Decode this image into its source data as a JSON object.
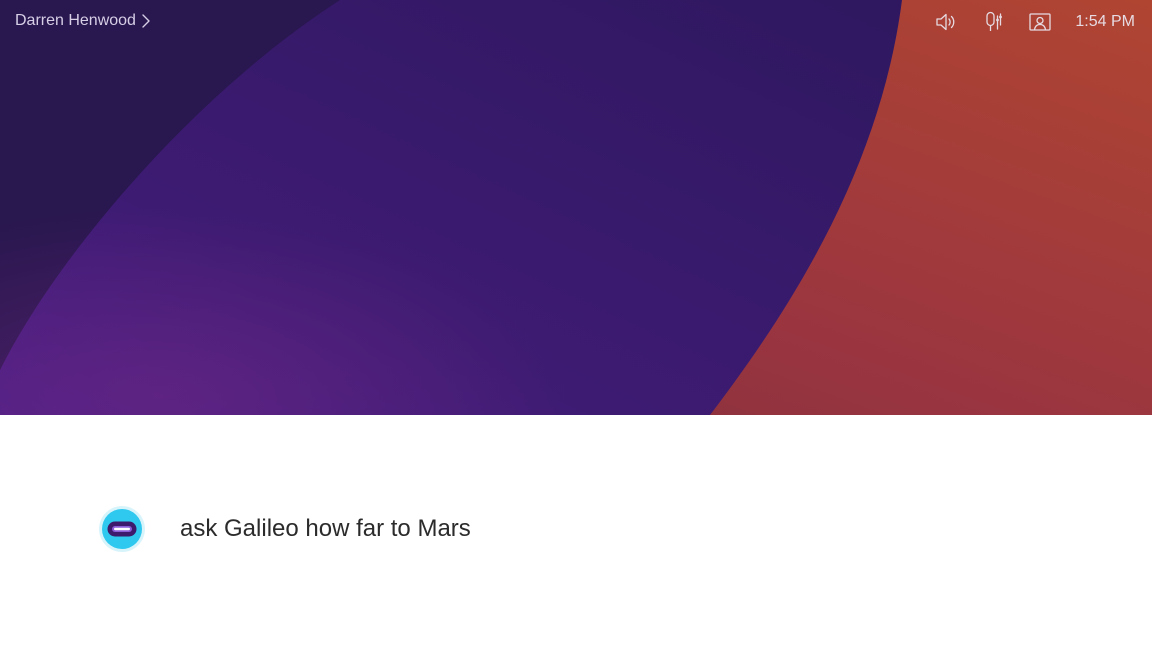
{
  "header": {
    "user_name": "Darren Henwood",
    "time": "1:54 PM",
    "icons": [
      "speaker-icon",
      "microphone-icon",
      "selfview-icon"
    ]
  },
  "assistant": {
    "icon": "assistant-icon",
    "transcript": "ask Galileo how far to Mars"
  },
  "colors": {
    "background_dark": "#28154a",
    "background_mid": "#3b1a6b",
    "background_orange": "#a74232",
    "accent_cyan": "#2fc8ee",
    "text_light": "#d6cfe6"
  }
}
